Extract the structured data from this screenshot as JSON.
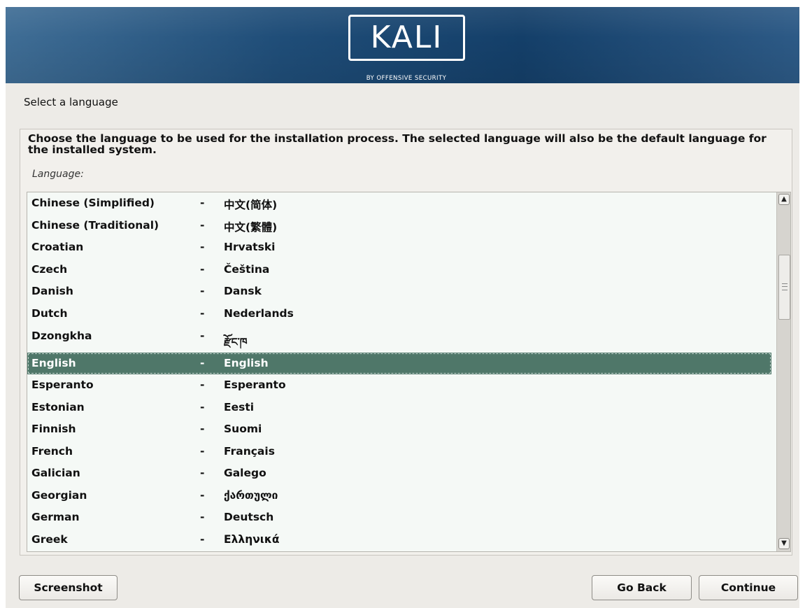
{
  "banner": {
    "logo_text": "KALI",
    "logo_tagline": "BY OFFENSIVE SECURITY"
  },
  "page_title": "Select a language",
  "description": "Choose the language to be used for the installation process. The selected language will also be the default language for the installed system.",
  "list_label": "Language:",
  "languages": [
    {
      "name": "Chinese (Simplified)",
      "sep": "-",
      "native": "中文(简体)"
    },
    {
      "name": "Chinese (Traditional)",
      "sep": "-",
      "native": "中文(繁體)"
    },
    {
      "name": "Croatian",
      "sep": "-",
      "native": "Hrvatski"
    },
    {
      "name": "Czech",
      "sep": "-",
      "native": "Čeština"
    },
    {
      "name": "Danish",
      "sep": "-",
      "native": "Dansk"
    },
    {
      "name": "Dutch",
      "sep": "-",
      "native": "Nederlands"
    },
    {
      "name": "Dzongkha",
      "sep": "-",
      "native": "རྫོང་ཁ"
    },
    {
      "name": "English",
      "sep": "-",
      "native": "English",
      "selected": true
    },
    {
      "name": "Esperanto",
      "sep": "-",
      "native": "Esperanto"
    },
    {
      "name": "Estonian",
      "sep": "-",
      "native": "Eesti"
    },
    {
      "name": "Finnish",
      "sep": "-",
      "native": "Suomi"
    },
    {
      "name": "French",
      "sep": "-",
      "native": "Français"
    },
    {
      "name": "Galician",
      "sep": "-",
      "native": "Galego"
    },
    {
      "name": "Georgian",
      "sep": "-",
      "native": "ქართული"
    },
    {
      "name": "German",
      "sep": "-",
      "native": "Deutsch"
    },
    {
      "name": "Greek",
      "sep": "-",
      "native": "Ελληνικά"
    }
  ],
  "scrollbar": {
    "up_icon": "▲",
    "down_icon": "▼"
  },
  "buttons": {
    "screenshot": "Screenshot",
    "go_back": "Go Back",
    "continue": "Continue"
  },
  "colors": {
    "selection": "#4f7769",
    "banner": "#1f4d78"
  }
}
